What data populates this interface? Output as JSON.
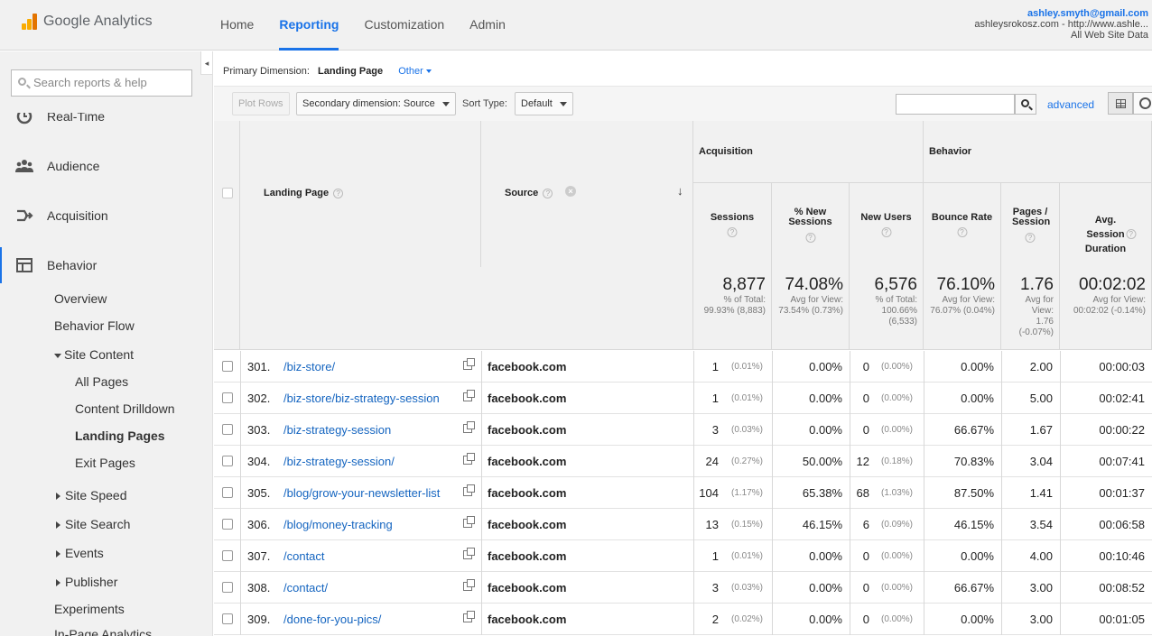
{
  "app": {
    "name": "Google Analytics",
    "brand_colors": [
      "#f9ab00",
      "#e37400"
    ],
    "accent": "#1a73e8"
  },
  "nav": {
    "tabs": [
      {
        "label": "Home",
        "active": false
      },
      {
        "label": "Reporting",
        "active": true
      },
      {
        "label": "Customization",
        "active": false
      },
      {
        "label": "Admin",
        "active": false
      }
    ]
  },
  "account": {
    "email": "ashley.smyth@gmail.com",
    "property": "ashleysrokosz.com - http://www.ashle...",
    "view": "All Web Site Data"
  },
  "sidebar": {
    "search_placeholder": "Search reports & help",
    "collapse_icon": "◂",
    "main_items": [
      {
        "label": "Real-Time",
        "icon": "clock-icon"
      },
      {
        "label": "Audience",
        "icon": "people-icon"
      },
      {
        "label": "Acquisition",
        "icon": "acquisition-icon"
      },
      {
        "label": "Behavior",
        "icon": "behavior-icon",
        "active": true
      }
    ],
    "behavior": {
      "overview": "Overview",
      "behavior_flow": "Behavior Flow",
      "site_content": "Site Content",
      "site_content_children": [
        {
          "label": "All Pages",
          "selected": false
        },
        {
          "label": "Content Drilldown",
          "selected": false
        },
        {
          "label": "Landing Pages",
          "selected": true
        },
        {
          "label": "Exit Pages",
          "selected": false
        }
      ],
      "site_speed": "Site Speed",
      "site_search": "Site Search",
      "events": "Events",
      "publisher": "Publisher",
      "experiments": "Experiments",
      "in_page": "In-Page Analytics"
    }
  },
  "primary_dimension": {
    "label": "Primary Dimension:",
    "value": "Landing Page",
    "other": "Other"
  },
  "toolbar": {
    "plot_rows": "Plot Rows",
    "secondary_dimension": "Secondary dimension: Source",
    "sort_type_label": "Sort Type:",
    "sort_type_value": "Default",
    "advanced": "advanced"
  },
  "table": {
    "col_landing_page": "Landing Page",
    "col_source": "Source",
    "group_acquisition": "Acquisition",
    "group_behavior": "Behavior",
    "metrics": [
      {
        "label": "Sessions"
      },
      {
        "label": "% New Sessions"
      },
      {
        "label": "New Users"
      },
      {
        "label": "Bounce Rate"
      },
      {
        "label": "Pages / Session"
      },
      {
        "label": "Avg. Session Duration"
      }
    ],
    "summary": [
      {
        "value": "8,877",
        "sub": "% of Total: 99.93% (8,883)"
      },
      {
        "value": "74.08%",
        "sub": "Avg for View: 73.54% (0.73%)"
      },
      {
        "value": "6,576",
        "sub": "% of Total: 100.66% (6,533)"
      },
      {
        "value": "76.10%",
        "sub": "Avg for View: 76.07% (0.04%)"
      },
      {
        "value": "1.76",
        "sub": "Avg for View: 1.76 (-0.07%)"
      },
      {
        "value": "00:02:02",
        "sub": "Avg for View: 00:02:02 (-0.14%)"
      }
    ],
    "rows": [
      {
        "idx": "301.",
        "page": "/biz-store/",
        "source": "facebook.com",
        "sessions": "1",
        "sessions_pct": "(0.01%)",
        "new_sessions": "0.00%",
        "new_users": "0",
        "new_users_pct": "(0.00%)",
        "bounce": "0.00%",
        "pages": "2.00",
        "duration": "00:00:03"
      },
      {
        "idx": "302.",
        "page": "/biz-store/biz-strategy-session",
        "source": "facebook.com",
        "sessions": "1",
        "sessions_pct": "(0.01%)",
        "new_sessions": "0.00%",
        "new_users": "0",
        "new_users_pct": "(0.00%)",
        "bounce": "0.00%",
        "pages": "5.00",
        "duration": "00:02:41"
      },
      {
        "idx": "303.",
        "page": "/biz-strategy-session",
        "source": "facebook.com",
        "sessions": "3",
        "sessions_pct": "(0.03%)",
        "new_sessions": "0.00%",
        "new_users": "0",
        "new_users_pct": "(0.00%)",
        "bounce": "66.67%",
        "pages": "1.67",
        "duration": "00:00:22"
      },
      {
        "idx": "304.",
        "page": "/biz-strategy-session/",
        "source": "facebook.com",
        "sessions": "24",
        "sessions_pct": "(0.27%)",
        "new_sessions": "50.00%",
        "new_users": "12",
        "new_users_pct": "(0.18%)",
        "bounce": "70.83%",
        "pages": "3.04",
        "duration": "00:07:41"
      },
      {
        "idx": "305.",
        "page": "/blog/grow-your-newsletter-list",
        "source": "facebook.com",
        "sessions": "104",
        "sessions_pct": "(1.17%)",
        "new_sessions": "65.38%",
        "new_users": "68",
        "new_users_pct": "(1.03%)",
        "bounce": "87.50%",
        "pages": "1.41",
        "duration": "00:01:37"
      },
      {
        "idx": "306.",
        "page": "/blog/money-tracking",
        "source": "facebook.com",
        "sessions": "13",
        "sessions_pct": "(0.15%)",
        "new_sessions": "46.15%",
        "new_users": "6",
        "new_users_pct": "(0.09%)",
        "bounce": "46.15%",
        "pages": "3.54",
        "duration": "00:06:58"
      },
      {
        "idx": "307.",
        "page": "/contact",
        "source": "facebook.com",
        "sessions": "1",
        "sessions_pct": "(0.01%)",
        "new_sessions": "0.00%",
        "new_users": "0",
        "new_users_pct": "(0.00%)",
        "bounce": "0.00%",
        "pages": "4.00",
        "duration": "00:10:46"
      },
      {
        "idx": "308.",
        "page": "/contact/",
        "source": "facebook.com",
        "sessions": "3",
        "sessions_pct": "(0.03%)",
        "new_sessions": "0.00%",
        "new_users": "0",
        "new_users_pct": "(0.00%)",
        "bounce": "66.67%",
        "pages": "3.00",
        "duration": "00:08:52"
      },
      {
        "idx": "309.",
        "page": "/done-for-you-pics/",
        "source": "facebook.com",
        "sessions": "2",
        "sessions_pct": "(0.02%)",
        "new_sessions": "0.00%",
        "new_users": "0",
        "new_users_pct": "(0.00%)",
        "bounce": "0.00%",
        "pages": "3.00",
        "duration": "00:01:05"
      }
    ]
  }
}
